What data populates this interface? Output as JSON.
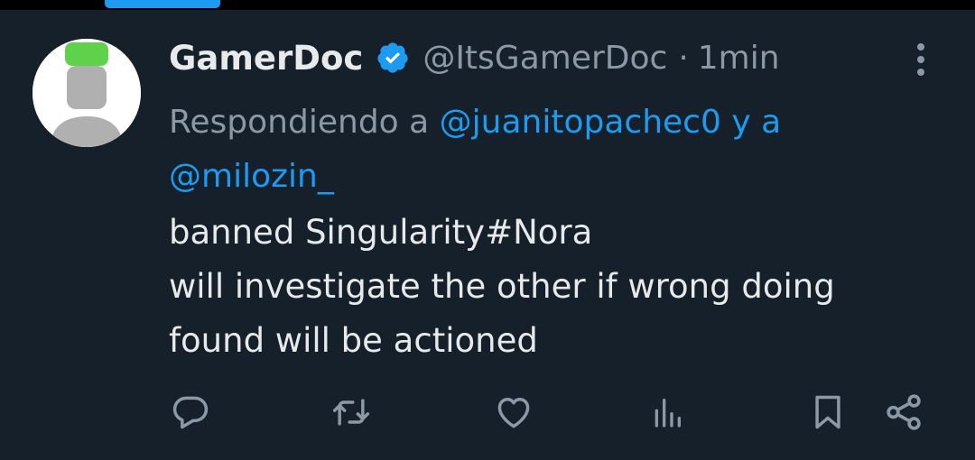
{
  "tweet": {
    "display_name": "GamerDoc",
    "handle": "@ItsGamerDoc",
    "separator": "·",
    "time": "1min",
    "reply_prefix": "Respondiendo a",
    "mention_1": "@juanitopachec0",
    "reply_and": "y a",
    "mention_2": "@milozin_",
    "body_lines": [
      "banned Singularity#Nora",
      "will investigate the other if wrong doing",
      "found will be actioned"
    ]
  },
  "icons": {
    "verified": "verified-badge-icon",
    "more": "more-vertical-icon",
    "reply": "reply-icon",
    "retweet": "retweet-icon",
    "like": "heart-icon",
    "views": "views-icon",
    "bookmark": "bookmark-icon",
    "share": "share-icon"
  },
  "colors": {
    "background": "#15202b",
    "accent": "#1d9bf0",
    "primary_text": "#e7e9ea",
    "secondary_text": "#8b98a5",
    "avatar_hat": "#5fd14a"
  }
}
